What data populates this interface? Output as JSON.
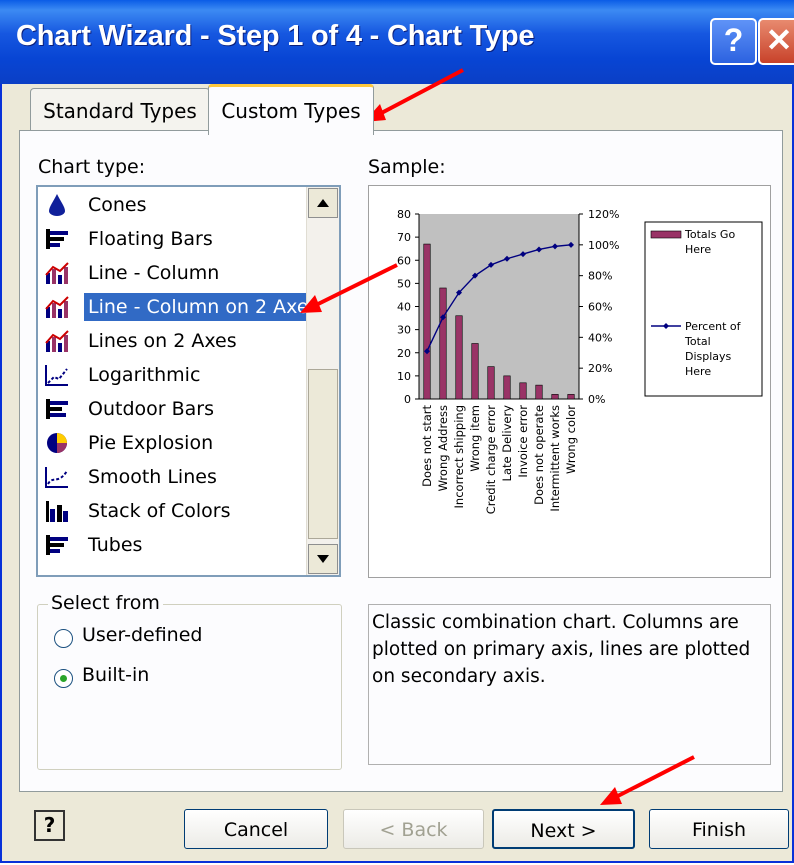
{
  "window": {
    "title": "Chart Wizard - Step 1 of 4 - Chart Type",
    "help_glyph": "?",
    "close_glyph": "✕"
  },
  "tabs": [
    {
      "label": "Standard Types"
    },
    {
      "label": "Custom Types"
    }
  ],
  "chart_type": {
    "label": "Chart type:",
    "items": [
      {
        "label": "Cones",
        "icon": "cone-icon"
      },
      {
        "label": "Floating Bars",
        "icon": "floating-bars-icon"
      },
      {
        "label": "Line - Column",
        "icon": "line-column-icon"
      },
      {
        "label": "Line - Column on 2 Axes",
        "icon": "line-column-2axes-icon",
        "selected": true
      },
      {
        "label": "Lines on 2 Axes",
        "icon": "lines-2axes-icon"
      },
      {
        "label": "Logarithmic",
        "icon": "logarithmic-icon"
      },
      {
        "label": "Outdoor Bars",
        "icon": "outdoor-bars-icon"
      },
      {
        "label": "Pie Explosion",
        "icon": "pie-icon"
      },
      {
        "label": "Smooth Lines",
        "icon": "smooth-lines-icon"
      },
      {
        "label": "Stack of Colors",
        "icon": "stack-colors-icon"
      },
      {
        "label": "Tubes",
        "icon": "tubes-icon"
      }
    ]
  },
  "sample": {
    "label": "Sample:"
  },
  "select_from": {
    "label": "Select from",
    "options": [
      {
        "label": "User-defined",
        "checked": false
      },
      {
        "label": "Built-in",
        "checked": true
      }
    ]
  },
  "description": "Classic combination chart. Columns are plotted on primary axis, lines are plotted on secondary axis.",
  "buttons": {
    "cancel": "Cancel",
    "back": "< Back",
    "next": "Next >",
    "finish": "Finish",
    "help": "?"
  },
  "colors": {
    "bar": "#993366",
    "line": "#000080",
    "plot_bg": "#c0c0c0",
    "selection": "#316ac5",
    "annotation_arrow": "#ff0000"
  },
  "chart_data": {
    "type": "bar",
    "categories": [
      "Does not start",
      "Wrong Address",
      "Incorrect shipping",
      "Wrong item",
      "Credit charge error",
      "Late Delivery",
      "Invoice error",
      "Does not operate",
      "Intermittent works",
      "Wrong color"
    ],
    "series": [
      {
        "name": "Totals Go Here",
        "type": "bar",
        "axis": "primary",
        "values": [
          67,
          48,
          36,
          24,
          14,
          10,
          7,
          6,
          2,
          2
        ]
      },
      {
        "name": "Percent of Total Displays Here",
        "type": "line",
        "axis": "secondary",
        "values": [
          0.31,
          0.53,
          0.69,
          0.8,
          0.87,
          0.91,
          0.94,
          0.97,
          0.99,
          1.0
        ]
      }
    ],
    "y_ticks": [
      "0",
      "10",
      "20",
      "30",
      "40",
      "50",
      "60",
      "70",
      "80"
    ],
    "y2_ticks": [
      "0%",
      "20%",
      "40%",
      "60%",
      "80%",
      "100%",
      "120%"
    ],
    "ylim": [
      0,
      80
    ],
    "y2lim": [
      0,
      1.2
    ],
    "legend": "right"
  }
}
